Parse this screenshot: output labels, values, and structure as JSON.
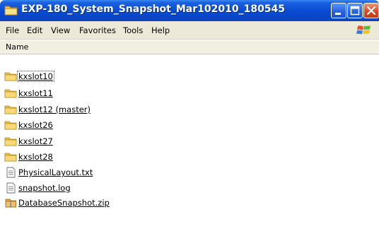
{
  "window": {
    "title": "EXP-180_System_Snapshot_Mar102010_180545",
    "buttons": [
      "minimize-icon",
      "maximize-icon",
      "close-icon"
    ]
  },
  "menu": {
    "items": [
      {
        "label": "File"
      },
      {
        "label": "Edit"
      },
      {
        "label": "View"
      },
      {
        "label": "Favorites"
      },
      {
        "label": "Tools"
      },
      {
        "label": "Help"
      }
    ],
    "logo": "windows-logo-icon"
  },
  "list": {
    "header": "Name",
    "items": [
      {
        "label": "kxslot10",
        "icon": "folder-icon",
        "focused": true
      },
      {
        "label": "kxslot11",
        "icon": "folder-icon"
      },
      {
        "label": "kxslot12 (master)",
        "icon": "folder-icon"
      },
      {
        "label": "kxslot26",
        "icon": "folder-icon"
      },
      {
        "label": "kxslot27",
        "icon": "folder-icon"
      },
      {
        "label": "kxslot28",
        "icon": "folder-icon"
      },
      {
        "label": "PhysicalLayout.txt",
        "icon": "text-file-icon"
      },
      {
        "label": "snapshot.log",
        "icon": "text-file-icon"
      },
      {
        "label": "DatabaseSnapshot.zip",
        "icon": "zip-file-icon"
      }
    ]
  },
  "colors": {
    "titlebar": "#0a4cd3",
    "close_button": "#dc4a24",
    "menubar": "#ece9d8",
    "folder": "#f5d66a"
  }
}
